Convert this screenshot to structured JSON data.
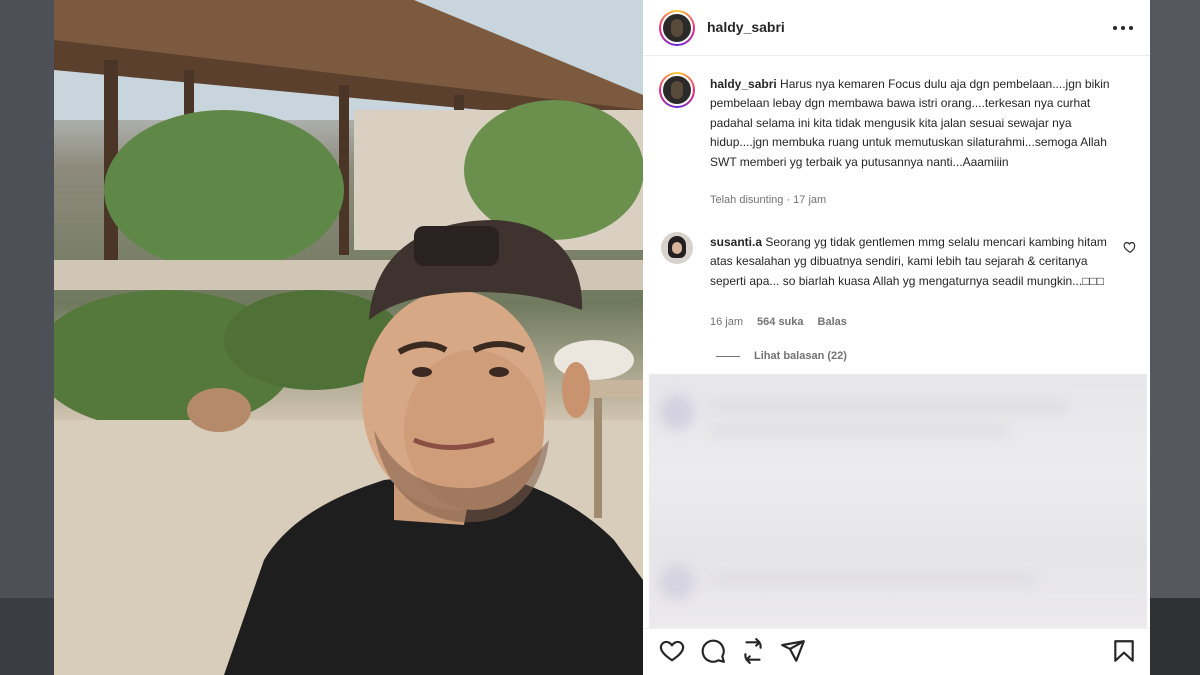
{
  "colors": {
    "text": "#262626",
    "muted": "#737373",
    "story_ring": "#ee2a7b"
  },
  "post": {
    "username": "haldy_sabri",
    "more_icon": "more-horizontal-icon"
  },
  "caption": {
    "username": "haldy_sabri",
    "text": "Harus nya kemaren Focus dulu aja dgn pembelaan....jgn bikin pembelaan lebay dgn membawa bawa istri orang....terkesan nya curhat padahal selama ini kita tidak mengusik kita jalan sesuai sewajar nya hidup....jgn membuka ruang untuk memutuskan silaturahmi...semoga Allah SWT memberi yg terbaik ya putusannya nanti...Aaamiiin",
    "meta": "Telah disunting · 17 jam"
  },
  "comment": {
    "username": "susanti.a",
    "text": "Seorang yg tidak gentlemen mmg selalu mencari kambing hitam atas kesalahan yg dibuatnya sendiri, kami lebih tau sejarah & ceritanya seperti apa... so biarlah kuasa Allah yg mengaturnya seadil mungkin...□□□",
    "time": "16 jam",
    "likes": "564 suka",
    "reply": "Balas",
    "view_replies": "Lihat balasan (22)"
  },
  "actions": [
    "heart-icon",
    "comment-icon",
    "repost-icon",
    "share-icon",
    "bookmark-icon"
  ]
}
